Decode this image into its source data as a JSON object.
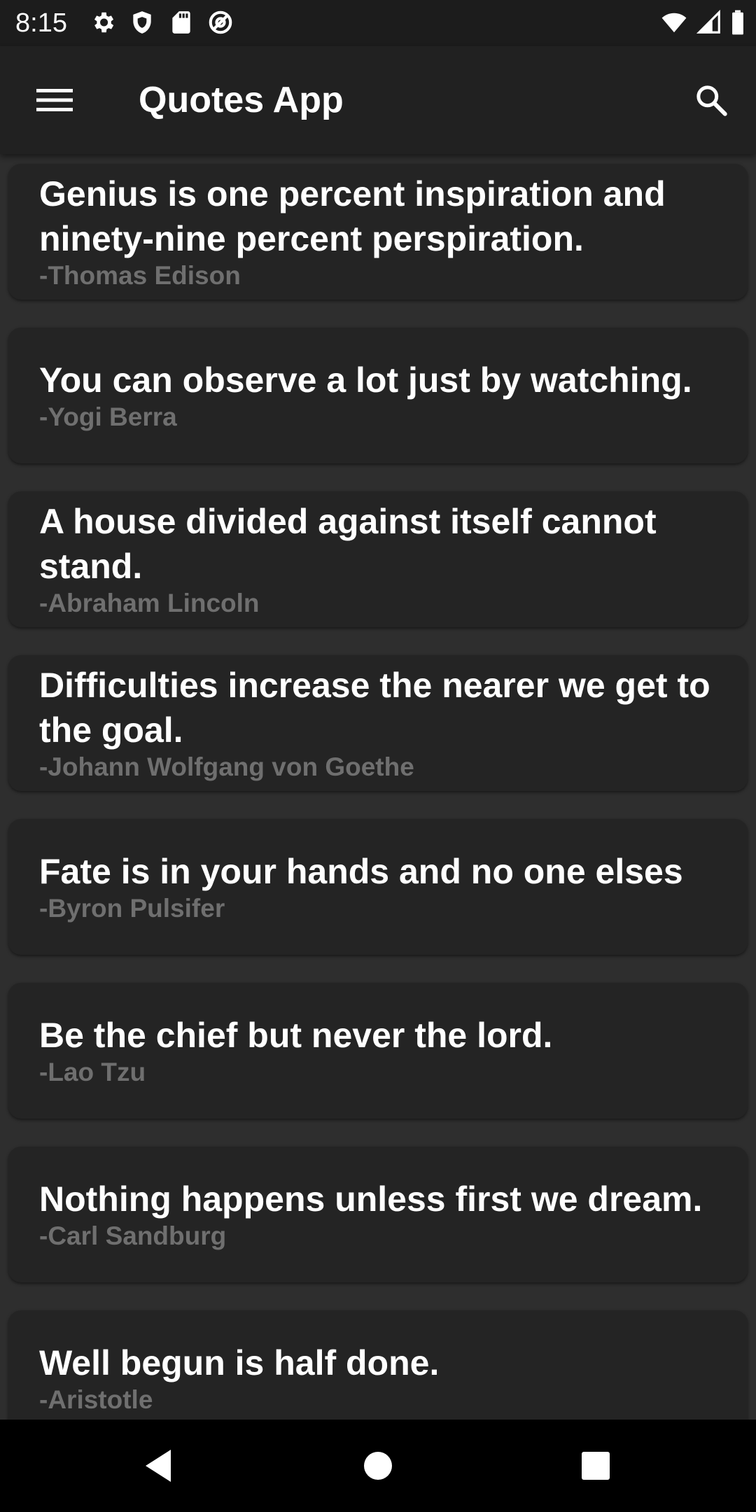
{
  "status_bar": {
    "time": "8:15",
    "left_icons": [
      "settings-icon",
      "shield-icon",
      "sd-card-icon",
      "at-sign-icon"
    ],
    "right_icons": [
      "wifi-icon",
      "signal-icon",
      "battery-icon"
    ]
  },
  "app_bar": {
    "title": "Quotes App",
    "menu_icon": "hamburger-menu-icon",
    "search_icon": "search-icon"
  },
  "quotes": [
    {
      "text": "Genius is one percent inspiration and ninety-nine percent perspiration.",
      "author": "-Thomas Edison"
    },
    {
      "text": "You can observe a lot just by watching.",
      "author": "-Yogi Berra"
    },
    {
      "text": "A house divided against itself cannot stand.",
      "author": "-Abraham Lincoln"
    },
    {
      "text": "Difficulties increase the nearer we get to the goal.",
      "author": "-Johann Wolfgang von Goethe"
    },
    {
      "text": "Fate is in your hands and no one elses",
      "author": "-Byron Pulsifer"
    },
    {
      "text": "Be the chief but never the lord.",
      "author": "-Lao Tzu"
    },
    {
      "text": "Nothing happens unless first we dream.",
      "author": "-Carl Sandburg"
    },
    {
      "text": "Well begun is half done.",
      "author": "-Aristotle"
    }
  ],
  "nav_bar": {
    "icons": [
      "back-icon",
      "home-icon",
      "recents-icon"
    ]
  },
  "colors": {
    "background": "#2e2e2e",
    "card": "#242424",
    "app_bar": "#212121",
    "quote_text": "#ffffff",
    "author_text": "#6f6f6f"
  }
}
